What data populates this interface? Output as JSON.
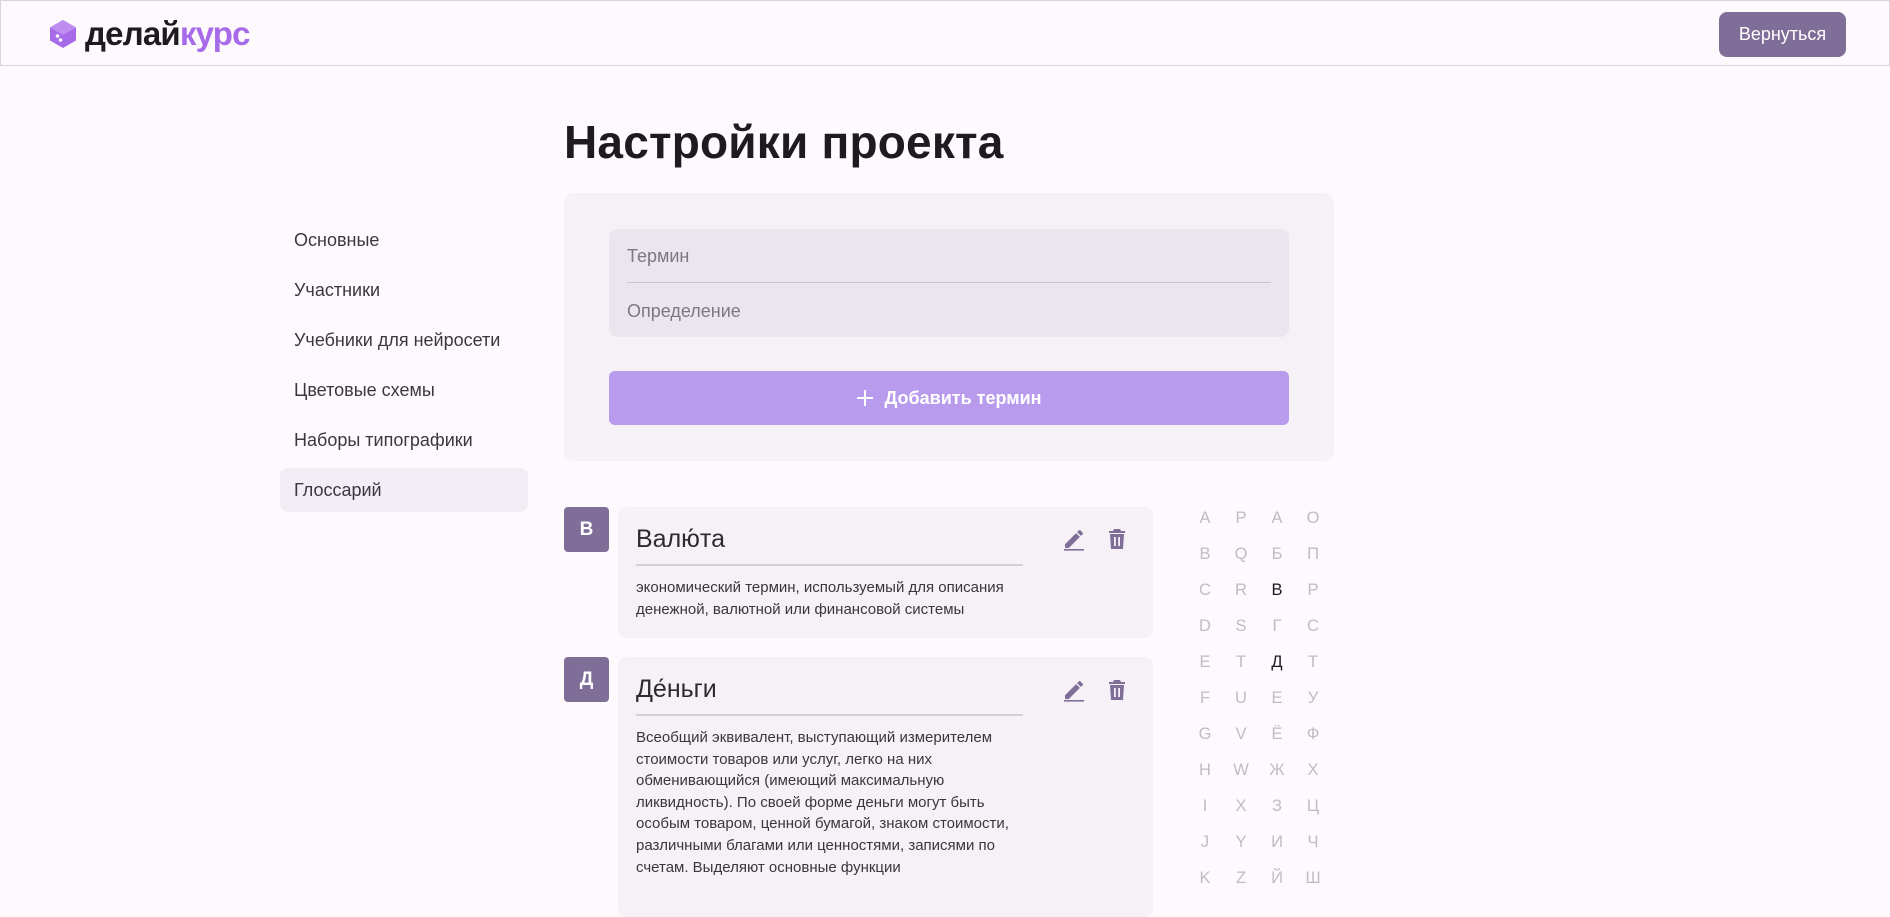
{
  "header": {
    "logo_part1": "делай",
    "logo_part2": "курс",
    "back_label": "Вернуться",
    "logo_color": "#a76ae8"
  },
  "page": {
    "title": "Настройки проекта"
  },
  "sidebar": {
    "items": [
      {
        "label": "Основные"
      },
      {
        "label": "Участники"
      },
      {
        "label": "Учебники для нейросети"
      },
      {
        "label": "Цветовые схемы"
      },
      {
        "label": "Наборы типографики"
      },
      {
        "label": "Глоссарий"
      }
    ],
    "active": "Глоссарий"
  },
  "form": {
    "term_placeholder": "Термин",
    "definition_placeholder": "Определение",
    "term_value": "",
    "definition_value": "",
    "add_label": "Добавить термин",
    "add_icon": "plus-icon"
  },
  "glossary": [
    {
      "letter": "В",
      "term": "Валю́та",
      "definition": "экономический термин, используемый для описания денежной, валютной или финансовой системы"
    },
    {
      "letter": "Д",
      "term": "Де́ньги",
      "definition": "Всеобщий эквивалент, выступающий измерителем стоимости товаров или услуг, легко на них обменивающийся (имеющий максимальную ликвидность). По своей форме деньги могут быть особым товаром, ценной бумагой, знаком стоимости, различными благами или ценностями, записями по счетам. Выделяют основные функции"
    }
  ],
  "actions": {
    "edit_icon": "pencil-icon",
    "delete_icon": "trash-icon"
  },
  "alphabet": {
    "columns": [
      [
        "A",
        "B",
        "C",
        "D",
        "E",
        "F",
        "G",
        "H",
        "I",
        "J",
        "K"
      ],
      [
        "P",
        "Q",
        "R",
        "S",
        "T",
        "U",
        "V",
        "W",
        "X",
        "Y",
        "Z"
      ],
      [
        "А",
        "Б",
        "В",
        "Г",
        "Д",
        "Е",
        "Ё",
        "Ж",
        "З",
        "И",
        "Й"
      ],
      [
        "О",
        "П",
        "Р",
        "С",
        "Т",
        "У",
        "Ф",
        "Х",
        "Ц",
        "Ч",
        "Ш"
      ]
    ],
    "active": [
      "В",
      "Д"
    ]
  },
  "colors": {
    "accent": "#7f6f98",
    "add_button": "#b99bee",
    "background": "#fdf9fd",
    "panel": "#f5f1f6"
  }
}
